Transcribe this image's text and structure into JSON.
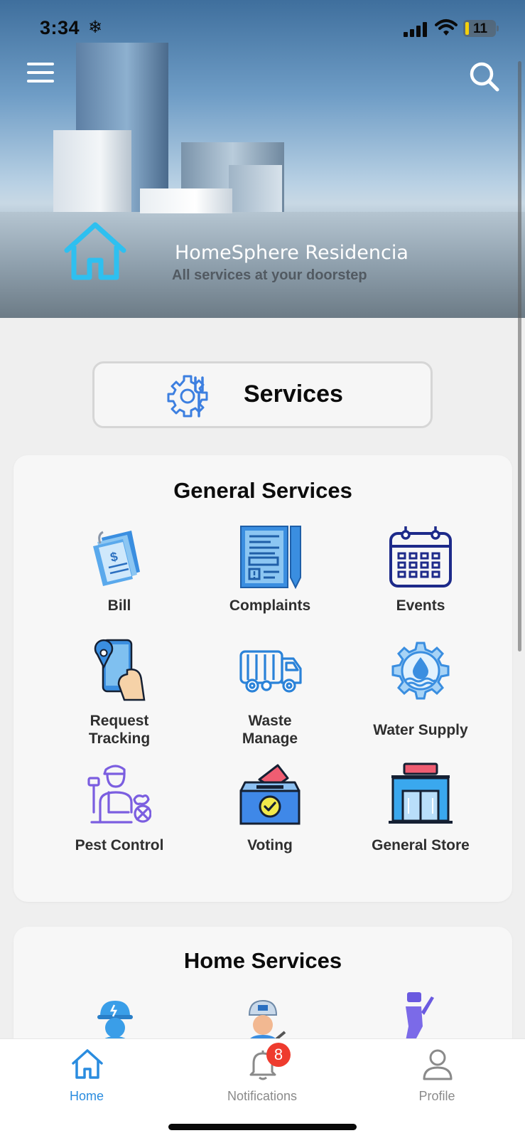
{
  "status_bar": {
    "time": "3:34",
    "battery": "11"
  },
  "hero": {
    "title": "HomeSphere Residencia",
    "subtitle": "All services at your doorstep"
  },
  "services_button": {
    "label": "Services"
  },
  "general_services": {
    "title": "General Services",
    "items": [
      {
        "label": "Bill",
        "icon": "bill-icon"
      },
      {
        "label": "Complaints",
        "icon": "complaints-icon"
      },
      {
        "label": "Events",
        "icon": "calendar-icon"
      },
      {
        "label": "Request\nTracking",
        "icon": "location-phone-icon"
      },
      {
        "label": "Waste\nManage",
        "icon": "garbage-truck-icon"
      },
      {
        "label": "Water Supply",
        "icon": "water-gear-icon"
      },
      {
        "label": "Pest Control",
        "icon": "pest-control-icon"
      },
      {
        "label": "Voting",
        "icon": "ballot-box-icon"
      },
      {
        "label": "General Store",
        "icon": "store-icon"
      }
    ]
  },
  "home_services": {
    "title": "Home Services"
  },
  "bottom_nav": {
    "home": "Home",
    "notifications": "Notifications",
    "notifications_badge": "8",
    "profile": "Profile"
  },
  "colors": {
    "accent": "#2a8cdf",
    "badge": "#ee3b2e",
    "inactive": "#8a8a8a"
  }
}
